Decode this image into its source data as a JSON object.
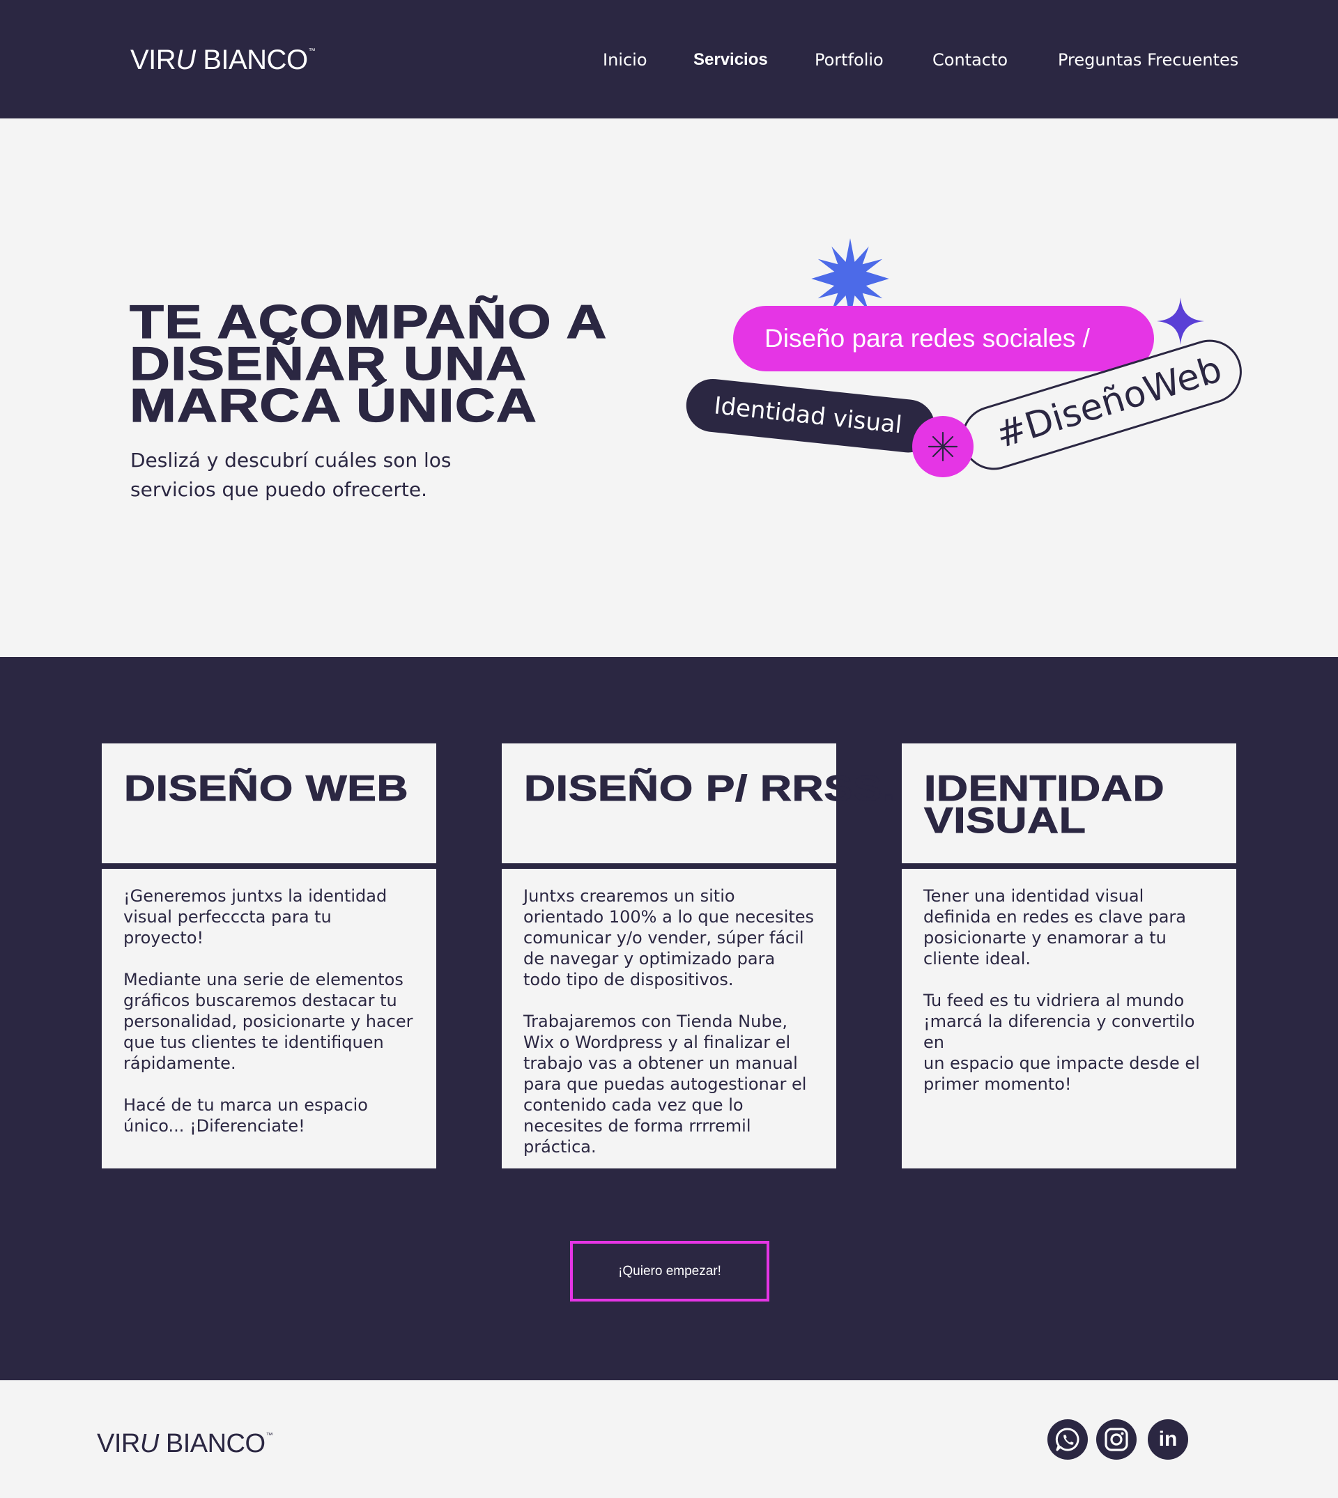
{
  "brand": {
    "logo_a": "VIR",
    "logo_u": "U",
    "logo_b": " BIANCO",
    "logo_tm": "™"
  },
  "nav": {
    "inicio": "Inicio",
    "servicios": "Servicios",
    "portfolio": "Portfolio",
    "contacto": "Contacto",
    "faq": "Preguntas Frecuentes"
  },
  "hero": {
    "title": "TE ACOMPAÑO A DISEÑAR UNA MARCA ÚNICA",
    "subtitle": "Deslizá y descubrí cuáles son los servicios que puedo ofrecerte."
  },
  "tags": {
    "social": "Diseño para redes sociales /",
    "identity": "Identidad visual",
    "web": "#DiseñoWeb"
  },
  "cards": [
    {
      "title": "DISEÑO WEB",
      "body": "¡Generemos juntxs la identidad visual perfecccta para tu proyecto!\n\nMediante una serie de elementos gráficos buscaremos destacar tu personalidad, posicionarte y hacer que tus clientes te identifiquen rápidamente.\n\nHacé de tu marca un espacio único... ¡Diferenciate!"
    },
    {
      "title": "DISEÑO P/ RRSS.",
      "body": "Juntxs crearemos un sitio orientado 100% a lo que necesites comunicar y/o vender, súper fácil de navegar y optimizado para todo tipo de dispositivos.\n\nTrabajaremos con Tienda Nube, Wix o Wordpress y al finalizar el trabajo vas a obtener un manual para que puedas autogestionar el contenido cada vez que lo necesites de forma rrrremil práctica."
    },
    {
      "title": "IDENTIDAD VISUAL",
      "body": "Tener una identidad visual definida en redes es clave para posicionarte y enamorar a tu cliente ideal.\n\nTu feed es tu vidriera al mundo ¡marcá la diferencia y convertilo en\nun espacio que impacte desde el primer momento!"
    }
  ],
  "cta": {
    "label": "¡Quiero empezar!"
  },
  "footer": {
    "social": [
      {
        "icon": "whatsapp-icon"
      },
      {
        "icon": "instagram-icon"
      },
      {
        "icon": "linkedin-icon",
        "glyph": "in"
      }
    ]
  },
  "colors": {
    "navy": "#2b2742",
    "pink": "#e535e5",
    "blue": "#4c6ae8",
    "violet": "#5a3fd6",
    "background": "#f4f4f4"
  }
}
